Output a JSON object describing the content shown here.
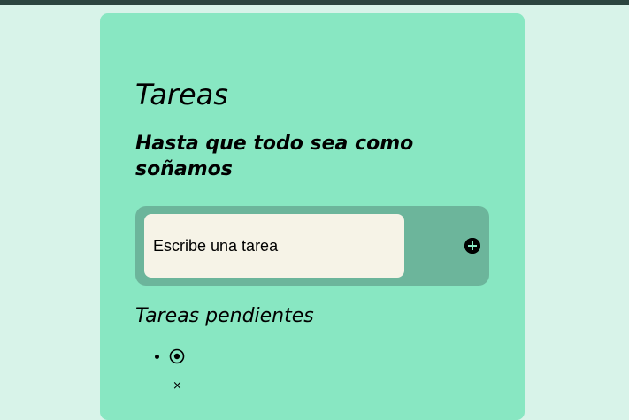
{
  "app": {
    "title": "Tareas",
    "subtitle": "Hasta que todo sea como soñamos"
  },
  "form": {
    "input_placeholder": "Escribe una tarea",
    "input_value": "",
    "add_icon": "plus-circle-icon"
  },
  "pending": {
    "title": "Tareas pendientes",
    "items": [
      {
        "text": "",
        "check_icon": "radio-circle-icon",
        "delete_symbol": "×"
      }
    ]
  },
  "colors": {
    "page_background": "#d8f3e9",
    "top_bar": "#2c4540",
    "card": "#88e7c2",
    "input_bar": "#6cb59b",
    "input_field": "#f6f3e7",
    "text": "#000000"
  }
}
